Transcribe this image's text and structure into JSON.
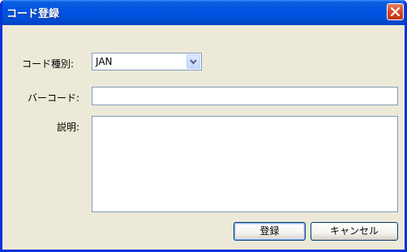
{
  "window": {
    "title": "コード登録"
  },
  "form": {
    "code_type_label": "コード種別:",
    "code_type_value": "JAN",
    "barcode_label": "バーコード:",
    "barcode_value": "",
    "description_label": "説明:",
    "description_value": ""
  },
  "buttons": {
    "register": "登録",
    "cancel": "キャンセル"
  },
  "colors": {
    "titlebar": "#0054e3",
    "window_bg": "#ece9d8",
    "close": "#d74a23"
  },
  "icons": {
    "close": "close-icon",
    "dropdown": "chevron-down-icon"
  }
}
